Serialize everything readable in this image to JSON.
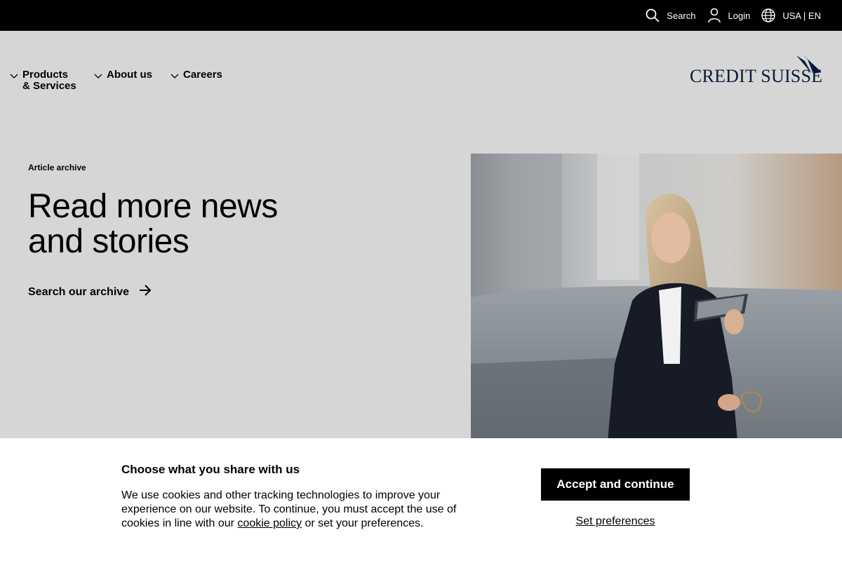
{
  "topbar": {
    "search_label": "Search",
    "login_label": "Login",
    "region_label": "USA | EN"
  },
  "nav": {
    "products_label": "Products\n& Services",
    "about_label": "About us",
    "careers_label": "Careers"
  },
  "logo": {
    "text": "CREDIT SUISSE",
    "color": "#0a1a3c"
  },
  "hero": {
    "eyebrow": "Article archive",
    "title": "Read more news\nand stories",
    "link_label": "Search our archive"
  },
  "cookie_banner": {
    "title": "Choose what you share with us",
    "text_before_link": "We use cookies and other tracking technologies to improve your experience on our website. To continue, you must accept the use of cookies in line with our ",
    "link_label": "cookie policy",
    "text_after_link": " or set your preferences.",
    "accept_label": "Accept and continue",
    "preferences_label": "Set preferences"
  },
  "icons": {
    "search": "search-icon",
    "login": "user-icon",
    "region": "globe-icon",
    "chevron": "chevron-down-icon",
    "arrow": "arrow-right-icon"
  },
  "colors": {
    "topbar_bg": "#000000",
    "page_bg": "#d6d6d6",
    "banner_bg": "#ffffff",
    "logo_navy": "#0a1a3c"
  }
}
